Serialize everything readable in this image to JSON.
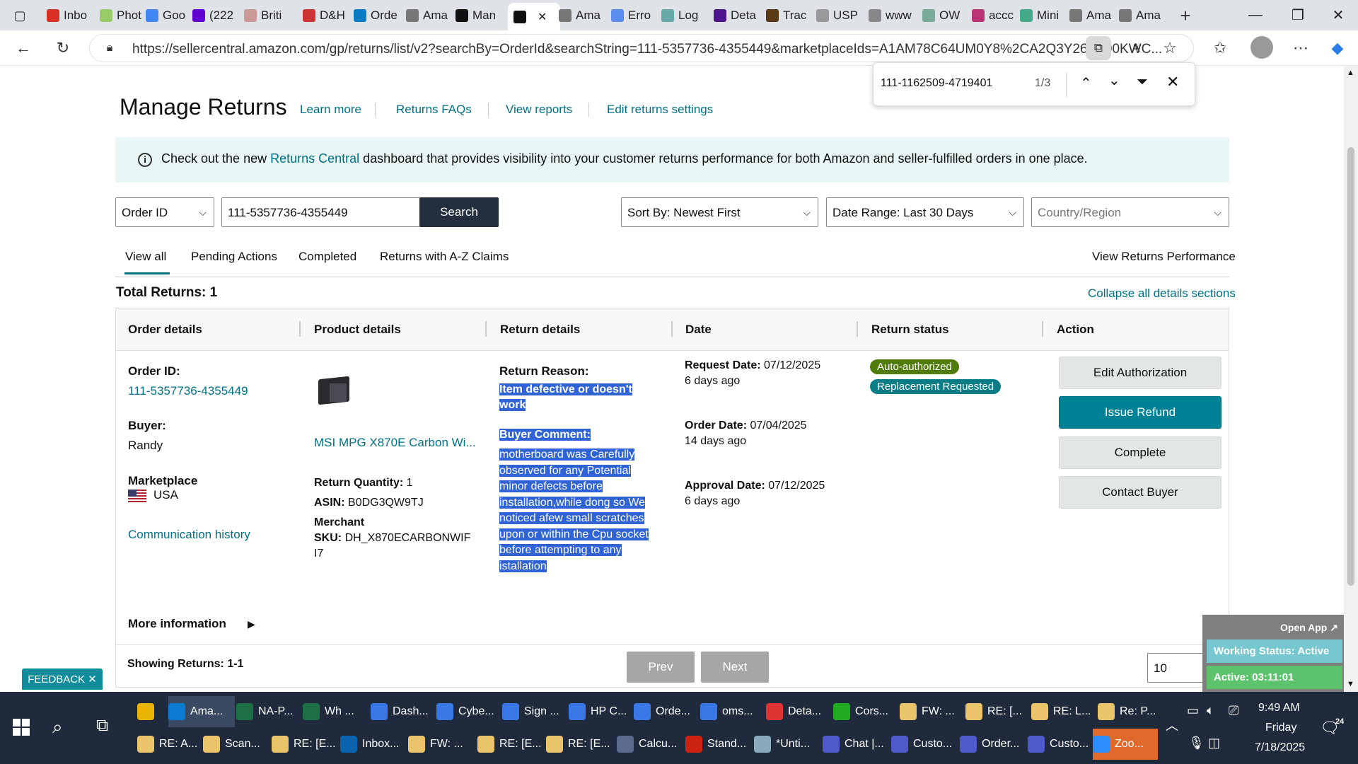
{
  "browser": {
    "tabs": [
      {
        "label": "Inbo",
        "icon": "gmail-icon",
        "color": "#d93025"
      },
      {
        "label": "Phot",
        "icon": "photos-icon",
        "color": "#9c6"
      },
      {
        "label": "Goo",
        "icon": "google-icon",
        "color": "#4285f4"
      },
      {
        "label": "(222",
        "icon": "yahoo-mail-icon",
        "color": "#6001d2"
      },
      {
        "label": "Briti",
        "icon": "page-icon",
        "color": "#c99"
      },
      {
        "label": "D&H",
        "icon": "dh-icon",
        "color": "#c33"
      },
      {
        "label": "Orde",
        "icon": "ec-icon",
        "color": "#0a7cc2"
      },
      {
        "label": "Ama",
        "icon": "amazon-icon",
        "color": "#777"
      },
      {
        "label": "Man",
        "icon": "amazon-icon",
        "color": "#111"
      },
      {
        "label": "",
        "icon": "amazon-icon",
        "color": "#111"
      },
      {
        "label": "Ama",
        "icon": "amazon-icon",
        "color": "#777"
      },
      {
        "label": "Erro",
        "icon": "page-icon",
        "color": "#5b8def"
      },
      {
        "label": "Log",
        "icon": "page-icon",
        "color": "#6aa"
      },
      {
        "label": "Deta",
        "icon": "fedex-icon",
        "color": "#4d148c"
      },
      {
        "label": "Trac",
        "icon": "ups-icon",
        "color": "#5a3a14"
      },
      {
        "label": "USP",
        "icon": "usps-icon",
        "color": "#999"
      },
      {
        "label": "www",
        "icon": "link-icon",
        "color": "#888"
      },
      {
        "label": "OW",
        "icon": "page-icon",
        "color": "#7a9"
      },
      {
        "label": "accc",
        "icon": "page-icon",
        "color": "#b37"
      },
      {
        "label": "Mini",
        "icon": "page-icon",
        "color": "#4a8"
      },
      {
        "label": "Ama",
        "icon": "amazon-icon",
        "color": "#777"
      },
      {
        "label": "Ama",
        "icon": "amazon-icon",
        "color": "#777"
      }
    ],
    "url": "https://sellercentral.amazon.com/gp/returns/list/v2?searchBy=OrderId&searchString=111-5357736-4355449&marketplaceIds=A1AM78C64UM0Y8%2CA2Q3Y263D00KWC...",
    "find": {
      "query": "111-1162509-4719401",
      "count": "1/3"
    }
  },
  "page": {
    "title": "Manage Returns",
    "links": [
      "Learn more",
      "Returns FAQs",
      "View reports",
      "Edit returns settings"
    ],
    "banner": {
      "pre": "Check out the new ",
      "link": "Returns Central",
      "post": " dashboard that provides visibility into your customer returns performance for both Amazon and seller-fulfilled orders in one place."
    },
    "filters": {
      "search_by": "Order ID",
      "search_value": "111-5357736-4355449",
      "search_button": "Search",
      "sort": "Sort By: Newest First",
      "date_range": "Date Range: Last 30 Days",
      "country_placeholder": "Country/Region"
    },
    "tabs": [
      "View all",
      "Pending Actions",
      "Completed",
      "Returns with A-Z Claims"
    ],
    "view_performance": "View Returns Performance",
    "total": "Total Returns: 1",
    "collapse": "Collapse all details sections",
    "columns": [
      "Order details",
      "Product details",
      "Return details",
      "Date",
      "Return status",
      "Action"
    ],
    "row": {
      "order_id_label": "Order ID:",
      "order_id": "111-5357736-4355449",
      "buyer_label": "Buyer:",
      "buyer": "Randy",
      "marketplace_label": "Marketplace",
      "marketplace": "USA",
      "comm_history": "Communication history",
      "product_name": "MSI MPG X870E Carbon Wi...",
      "qty_label": "Return Quantity:",
      "qty": "1",
      "asin_label": "ASIN:",
      "asin": "B0DG3QW9TJ",
      "merchant_label": "Merchant",
      "sku_label": "SKU:",
      "sku_line1": "DH_X870ECARBONWIF",
      "sku_line2": "I7",
      "reason_label": "Return Reason:",
      "reason_lines": [
        "Item defective or doesn't",
        "work"
      ],
      "comment_label": "Buyer Comment:",
      "comment_lines": [
        "motherboard was Carefully",
        "observed for any Potential",
        "minor defects before",
        "installation,while dong so We",
        "noticed afew small scratches",
        "upon or within the Cpu socket",
        "before attempting to any",
        "istallation"
      ],
      "request_label": "Request Date:",
      "request_date": "07/12/2025",
      "request_ago": "6 days ago",
      "order_label": "Order Date:",
      "order_date": "07/04/2025",
      "order_ago": "14 days ago",
      "approval_label": "Approval Date:",
      "approval_date": "07/12/2025",
      "approval_ago": "6 days ago",
      "badge1": "Auto-authorized",
      "badge2": "Replacement Requested",
      "actions": [
        "Edit Authorization",
        "Issue Refund",
        "Complete",
        "Contact Buyer"
      ],
      "more_info": "More information"
    },
    "showing": "Showing Returns: 1-1",
    "prev": "Prev",
    "next": "Next",
    "page_size": "10",
    "feedback": "FEEDBACK",
    "widget": {
      "open_app": "Open App",
      "status": "Working Status: Active",
      "timer": "Active: 03:11:01"
    }
  },
  "taskbar": {
    "row1": [
      {
        "label": "",
        "icon": "file-explorer-icon",
        "color": "#e8b400"
      },
      {
        "label": "Ama...",
        "icon": "edge-icon",
        "color": "#0c7bd4"
      },
      {
        "label": "NA-P...",
        "icon": "excel-icon",
        "color": "#1d7044"
      },
      {
        "label": "Wh ...",
        "icon": "excel-icon",
        "color": "#1d7044"
      },
      {
        "label": "Dash...",
        "icon": "chrome-icon",
        "color": "#3b78e7"
      },
      {
        "label": "Cybe...",
        "icon": "chrome-icon",
        "color": "#3b78e7"
      },
      {
        "label": "Sign ...",
        "icon": "chrome-icon",
        "color": "#3b78e7"
      },
      {
        "label": "HP C...",
        "icon": "chrome-icon",
        "color": "#3b78e7"
      },
      {
        "label": "Orde...",
        "icon": "chrome-icon",
        "color": "#3b78e7"
      },
      {
        "label": "oms...",
        "icon": "chrome-icon",
        "color": "#3b78e7"
      },
      {
        "label": "Deta...",
        "icon": "chrome-icon",
        "color": "#d33"
      },
      {
        "label": "Cors...",
        "icon": "chrome-icon",
        "color": "#2a2"
      },
      {
        "label": "FW: ...",
        "icon": "mail-icon",
        "color": "#e9c46a"
      },
      {
        "label": "RE: [...",
        "icon": "mail-icon",
        "color": "#e9c46a"
      },
      {
        "label": "RE: L...",
        "icon": "mail-icon",
        "color": "#e9c46a"
      },
      {
        "label": "Re: P...",
        "icon": "mail-icon",
        "color": "#e9c46a"
      }
    ],
    "row2": [
      {
        "label": "RE: A...",
        "icon": "mail-icon",
        "color": "#e9c46a"
      },
      {
        "label": "Scan...",
        "icon": "mail-icon",
        "color": "#e9c46a"
      },
      {
        "label": "RE: [E...",
        "icon": "mail-icon",
        "color": "#e9c46a"
      },
      {
        "label": "Inbox...",
        "icon": "outlook-icon",
        "color": "#0a64ad"
      },
      {
        "label": "FW: ...",
        "icon": "mail-icon",
        "color": "#e9c46a"
      },
      {
        "label": "RE: [E...",
        "icon": "mail-icon",
        "color": "#e9c46a"
      },
      {
        "label": "RE: [E...",
        "icon": "mail-icon",
        "color": "#e9c46a"
      },
      {
        "label": "Calcu...",
        "icon": "calculator-icon",
        "color": "#5a6b8c"
      },
      {
        "label": "Stand...",
        "icon": "pdf-icon",
        "color": "#c21"
      },
      {
        "label": "*Unti...",
        "icon": "notepad-icon",
        "color": "#8ab"
      },
      {
        "label": "Chat |...",
        "icon": "teams-icon",
        "color": "#5059c9"
      },
      {
        "label": "Custo...",
        "icon": "teams-icon",
        "color": "#5059c9"
      },
      {
        "label": "Order...",
        "icon": "teams-icon",
        "color": "#5059c9"
      },
      {
        "label": "Custo...",
        "icon": "teams-icon",
        "color": "#5059c9"
      },
      {
        "label": "Zoo...",
        "icon": "zoom-icon",
        "color": "#2d8cff"
      }
    ],
    "clock": {
      "time": "9:49 AM",
      "day": "Friday",
      "date": "7/18/2025"
    },
    "notif_count": "24"
  },
  "colors": {
    "teal": "#007185",
    "refund": "#008296",
    "badge_green": "#507c0c",
    "badge_teal": "#0a7d86",
    "highlight": "#2f63d6"
  }
}
